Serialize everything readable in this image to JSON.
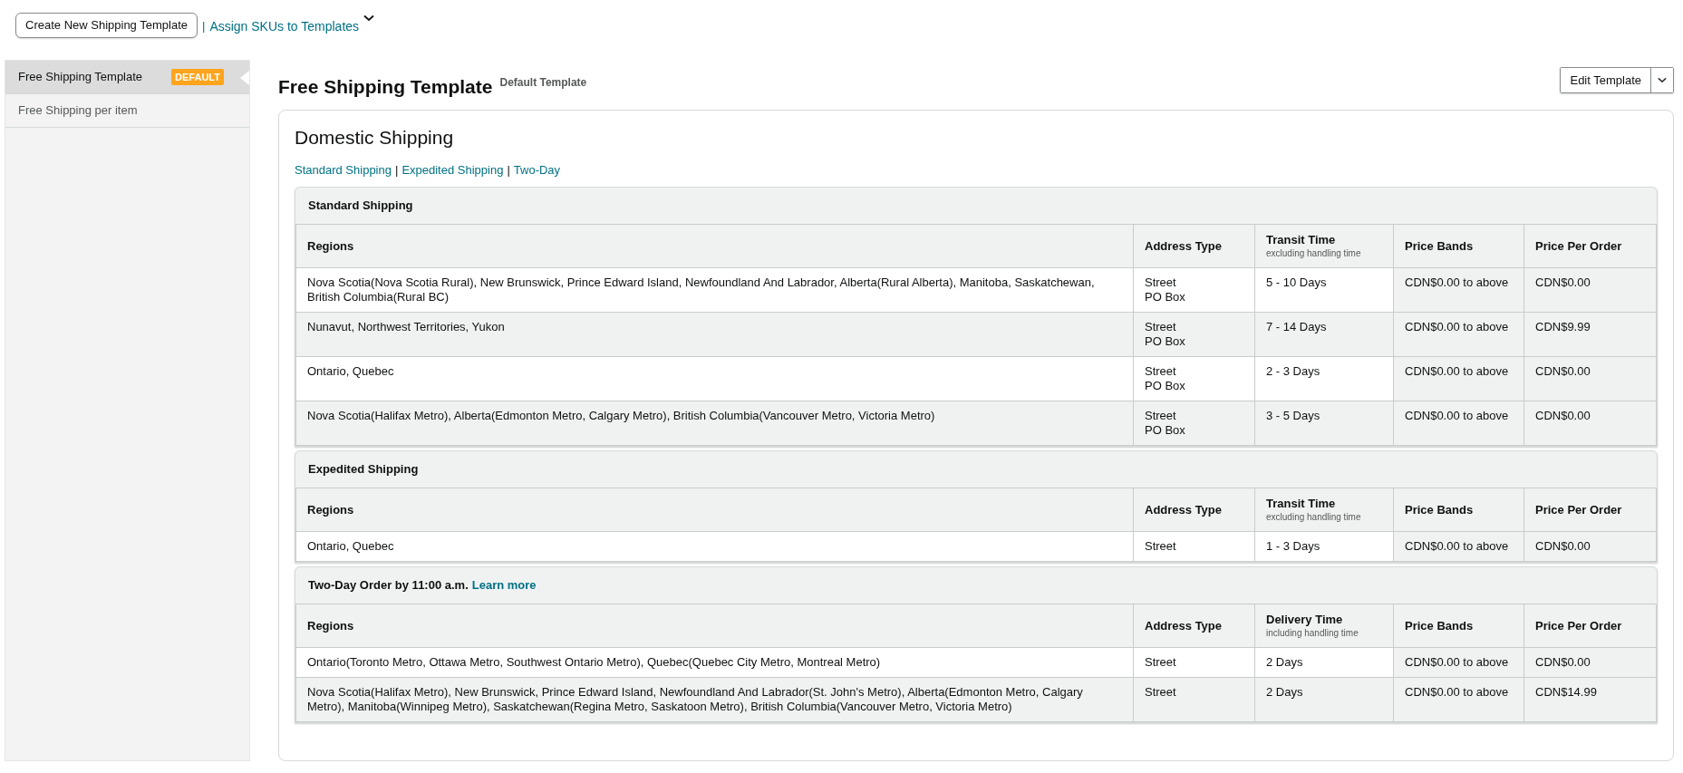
{
  "toolbar": {
    "create_button": "Create New Shipping Template",
    "separator": "|",
    "assign_link": "Assign SKUs to Templates"
  },
  "sidebar": {
    "items": [
      {
        "label": "Free Shipping Template",
        "badge": "DEFAULT",
        "selected": true
      },
      {
        "label": "Free Shipping per item",
        "selected": false
      }
    ]
  },
  "header": {
    "title": "Free Shipping Template",
    "subtitle": "Default Template",
    "edit_button": "Edit Template"
  },
  "card": {
    "title": "Domestic Shipping",
    "links": [
      "Standard Shipping",
      "Expedited Shipping",
      "Two-Day"
    ],
    "link_separator": "|",
    "sections": [
      {
        "title": "Standard Shipping",
        "columns": [
          {
            "label": "Regions"
          },
          {
            "label": "Address Type"
          },
          {
            "label": "Transit Time",
            "sub": "excluding handling time"
          },
          {
            "label": "Price Bands"
          },
          {
            "label": "Price Per Order"
          }
        ],
        "rows": [
          {
            "regions": "Nova Scotia(Nova Scotia Rural), New Brunswick, Prince Edward Island, Newfoundland And Labrador, Alberta(Rural Alberta), Manitoba, Saskatchewan, British Columbia(Rural BC)",
            "address_types": [
              "Street",
              "PO Box"
            ],
            "time": "5 - 10 Days",
            "price_band": "CDN$0.00 to above",
            "price": "CDN$0.00"
          },
          {
            "regions": "Nunavut, Northwest Territories, Yukon",
            "address_types": [
              "Street",
              "PO Box"
            ],
            "time": "7 - 14 Days",
            "price_band": "CDN$0.00 to above",
            "price": "CDN$9.99"
          },
          {
            "regions": "Ontario, Quebec",
            "address_types": [
              "Street",
              "PO Box"
            ],
            "time": "2 - 3 Days",
            "price_band": "CDN$0.00 to above",
            "price": "CDN$0.00"
          },
          {
            "regions": "Nova Scotia(Halifax Metro), Alberta(Edmonton Metro, Calgary Metro), British Columbia(Vancouver Metro, Victoria Metro)",
            "address_types": [
              "Street",
              "PO Box"
            ],
            "time": "3 - 5 Days",
            "price_band": "CDN$0.00 to above",
            "price": "CDN$0.00"
          }
        ]
      },
      {
        "title": "Expedited Shipping",
        "columns": [
          {
            "label": "Regions"
          },
          {
            "label": "Address Type"
          },
          {
            "label": "Transit Time",
            "sub": "excluding handling time"
          },
          {
            "label": "Price Bands"
          },
          {
            "label": "Price Per Order"
          }
        ],
        "rows": [
          {
            "regions": "Ontario, Quebec",
            "address_types": [
              "Street"
            ],
            "time": "1 - 3 Days",
            "price_band": "CDN$0.00 to above",
            "price": "CDN$0.00"
          }
        ]
      },
      {
        "title": "Two-Day Order by 11:00 a.m.",
        "link": "Learn more",
        "columns": [
          {
            "label": "Regions"
          },
          {
            "label": "Address Type"
          },
          {
            "label": "Delivery Time",
            "sub": "including handling time"
          },
          {
            "label": "Price Bands"
          },
          {
            "label": "Price Per Order"
          }
        ],
        "rows": [
          {
            "regions": "Ontario(Toronto Metro, Ottawa Metro, Southwest Ontario Metro), Quebec(Quebec City Metro, Montreal Metro)",
            "address_types": [
              "Street"
            ],
            "time": "2 Days",
            "price_band": "CDN$0.00 to above",
            "price": "CDN$0.00"
          },
          {
            "regions": "Nova Scotia(Halifax Metro), New Brunswick, Prince Edward Island, Newfoundland And Labrador(St. John's Metro), Alberta(Edmonton Metro, Calgary Metro), Manitoba(Winnipeg Metro), Saskatchewan(Regina Metro, Saskatoon Metro), British Columbia(Vancouver Metro, Victoria Metro)",
            "address_types": [
              "Street"
            ],
            "time": "2 Days",
            "price_band": "CDN$0.00 to above",
            "price": "CDN$14.99"
          }
        ]
      }
    ]
  }
}
